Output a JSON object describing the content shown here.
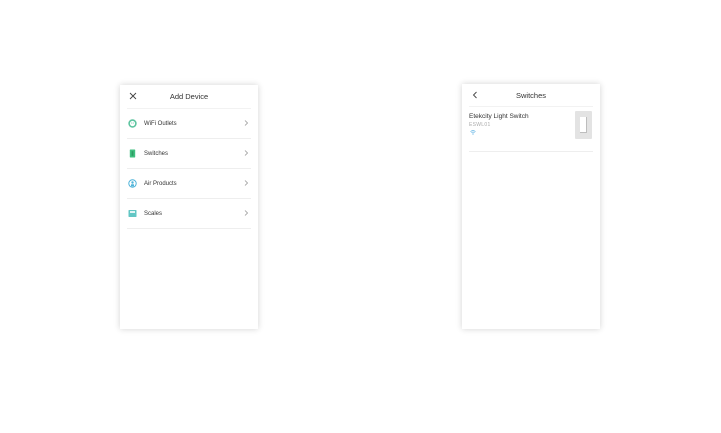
{
  "add_device_screen": {
    "title": "Add Device",
    "close_icon": "close-icon",
    "categories": [
      {
        "label": "WiFi Outlets",
        "icon": "outlet-icon",
        "icon_color": "#5ec4a0"
      },
      {
        "label": "Switches",
        "icon": "switch-icon",
        "icon_color": "#3fbf7f"
      },
      {
        "label": "Air Products",
        "icon": "air-purifier-icon",
        "icon_color": "#4fb3d9"
      },
      {
        "label": "Scales",
        "icon": "scale-icon",
        "icon_color": "#62c6c4"
      }
    ]
  },
  "switches_screen": {
    "title": "Switches",
    "back_icon": "chevron-left-icon",
    "device": {
      "name": "Etekcity Light Switch",
      "model": "ESWL01",
      "status_icon": "wifi-icon",
      "status_color": "#4aa8e0"
    }
  }
}
